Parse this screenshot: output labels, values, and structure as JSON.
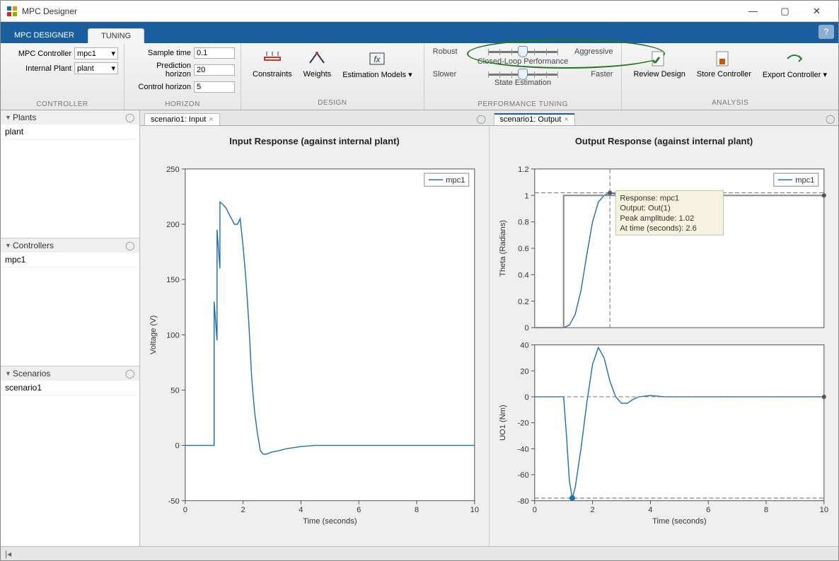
{
  "window": {
    "title": "MPC Designer"
  },
  "tabs": {
    "t0": "MPC DESIGNER",
    "t1": "TUNING"
  },
  "controller_group": {
    "lbl": "MPC Controller",
    "val": "mpc1",
    "lbl2": "Internal Plant",
    "val2": "plant",
    "name": "CONTROLLER"
  },
  "horizon_group": {
    "lblS": "Sample time",
    "valS": "0.1",
    "lblP": "Prediction horizon",
    "valP": "20",
    "lblC": "Control horizon",
    "valC": "5",
    "name": "HORIZON"
  },
  "design_group": {
    "b0": "Constraints",
    "b1": "Weights",
    "b2": "Estimation Models ▾",
    "name": "DESIGN"
  },
  "perf_group": {
    "s1_left": "Robust",
    "s1_mid": "Closed-Loop Performance",
    "s1_right": "Aggressive",
    "s2_left": "Slower",
    "s2_mid": "State Estimation",
    "s2_right": "Faster",
    "name": "PERFORMANCE TUNING"
  },
  "analysis_group": {
    "b0": "Review Design",
    "b1": "Store Controller",
    "b2": "Export Controller ▾",
    "name": "ANALYSIS"
  },
  "sidebar": {
    "plants": {
      "title": "Plants",
      "item": "plant"
    },
    "controllers": {
      "title": "Controllers",
      "item": "mpc1"
    },
    "scenarios": {
      "title": "Scenarios",
      "item": "scenario1"
    }
  },
  "doctabs": {
    "t0": "scenario1: Input",
    "t1": "scenario1: Output"
  },
  "input_plot": {
    "title": "Input Response (against internal plant)",
    "xlabel": "Time (seconds)",
    "ylabel": "Voltage (V)",
    "legend": "mpc1"
  },
  "output_plot": {
    "title": "Output Response (against internal plant)",
    "xlabel": "Time (seconds)",
    "ylabel1": "Theta (Radians)",
    "ylabel2": "UO1 (Nm)",
    "legend": "mpc1",
    "tooltip_l1": "Response: mpc1",
    "tooltip_l2": "Output: Out(1)",
    "tooltip_l3": "Peak amplitude: 1.02",
    "tooltip_l4": "At time (seconds): 2.6"
  },
  "chart_data": [
    {
      "type": "line",
      "title": "Input Response (against internal plant)",
      "xlabel": "Time (seconds)",
      "ylabel": "Voltage (V)",
      "xlim": [
        0,
        10
      ],
      "ylim": [
        -50,
        250
      ],
      "series": [
        {
          "name": "mpc1",
          "x": [
            0,
            1,
            1,
            1.1,
            1.1,
            1.2,
            1.2,
            1.3,
            1.4,
            1.5,
            1.6,
            1.7,
            1.8,
            1.9,
            2.0,
            2.1,
            2.2,
            2.3,
            2.4,
            2.5,
            2.6,
            2.7,
            2.8,
            2.9,
            3.0,
            3.2,
            3.5,
            4.0,
            4.5,
            5,
            6,
            8,
            10
          ],
          "y": [
            0,
            0,
            130,
            95,
            195,
            160,
            220,
            218,
            215,
            210,
            205,
            200,
            200,
            205,
            180,
            150,
            110,
            60,
            30,
            10,
            -5,
            -8,
            -8,
            -7,
            -6,
            -5,
            -3,
            -1,
            0,
            0,
            0,
            0,
            0
          ]
        }
      ]
    },
    {
      "type": "line",
      "title": "Output Response (against internal plant) – Theta",
      "xlabel": "Time (seconds)",
      "ylabel": "Theta (Radians)",
      "xlim": [
        0,
        10
      ],
      "ylim": [
        0,
        1.2
      ],
      "annotations": {
        "peak_amplitude": 1.02,
        "peak_time": 2.6
      },
      "series": [
        {
          "name": "mpc1",
          "x": [
            0,
            1.0,
            1.2,
            1.4,
            1.6,
            1.8,
            2.0,
            2.2,
            2.4,
            2.6,
            2.8,
            3.0,
            3.5,
            4,
            5,
            6,
            8,
            10
          ],
          "y": [
            0,
            0,
            0.02,
            0.1,
            0.28,
            0.55,
            0.8,
            0.95,
            1.0,
            1.02,
            1.01,
            1.0,
            1.0,
            1.0,
            1.0,
            1.0,
            1.0,
            1.0
          ]
        }
      ]
    },
    {
      "type": "line",
      "title": "Output Response (against internal plant) – UO1",
      "xlabel": "Time (seconds)",
      "ylabel": "UO1 (Nm)",
      "xlim": [
        0,
        10
      ],
      "ylim": [
        -80,
        40
      ],
      "series": [
        {
          "name": "mpc1",
          "x": [
            0,
            1.0,
            1.1,
            1.2,
            1.3,
            1.4,
            1.6,
            1.8,
            2.0,
            2.2,
            2.4,
            2.6,
            2.8,
            3.0,
            3.2,
            3.4,
            3.6,
            4.0,
            4.5,
            5,
            6,
            8,
            10
          ],
          "y": [
            0,
            0,
            -30,
            -65,
            -78,
            -70,
            -40,
            -5,
            25,
            38,
            30,
            12,
            0,
            -5,
            -5,
            -2,
            0,
            1,
            0,
            0,
            0,
            0,
            0
          ]
        }
      ]
    }
  ]
}
